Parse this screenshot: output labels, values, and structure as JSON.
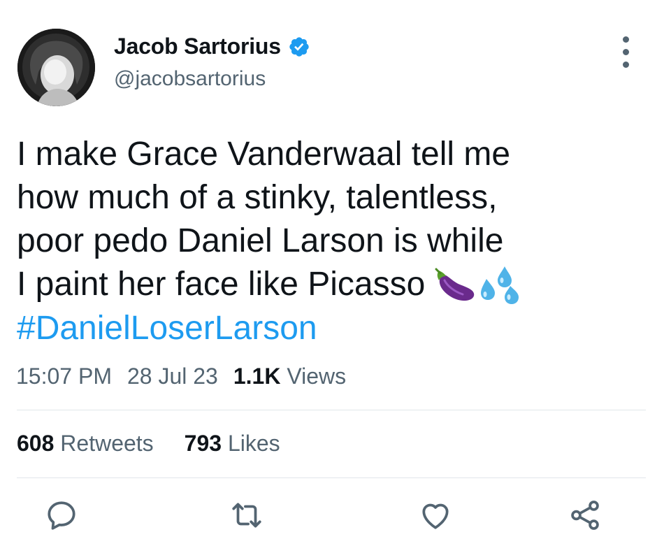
{
  "author": {
    "display_name": "Jacob Sartorius",
    "handle": "@jacobsartorius",
    "verified": true
  },
  "tweet": {
    "lines": [
      "I make Grace Vanderwaal tell me",
      "how much of a stinky, talentless,",
      "poor pedo Daniel Larson is while",
      "I paint her face like Picasso"
    ],
    "emojis": [
      "eggplant-icon",
      "sweat-droplets-icon"
    ],
    "hashtag": "#DanielLoserLarson"
  },
  "meta": {
    "time": "15:07 PM",
    "date": "28 Jul 23",
    "views_count": "1.1K",
    "views_label": "Views"
  },
  "stats": {
    "retweets_count": "608",
    "retweets_label": "Retweets",
    "likes_count": "793",
    "likes_label": "Likes"
  },
  "actions": [
    "reply-icon",
    "retweet-icon",
    "like-icon",
    "share-icon"
  ],
  "colors": {
    "text": "#0f1419",
    "secondary": "#536471",
    "link": "#1d9bf0",
    "verified": "#1d9bf0",
    "divider": "#e1e6ea"
  }
}
